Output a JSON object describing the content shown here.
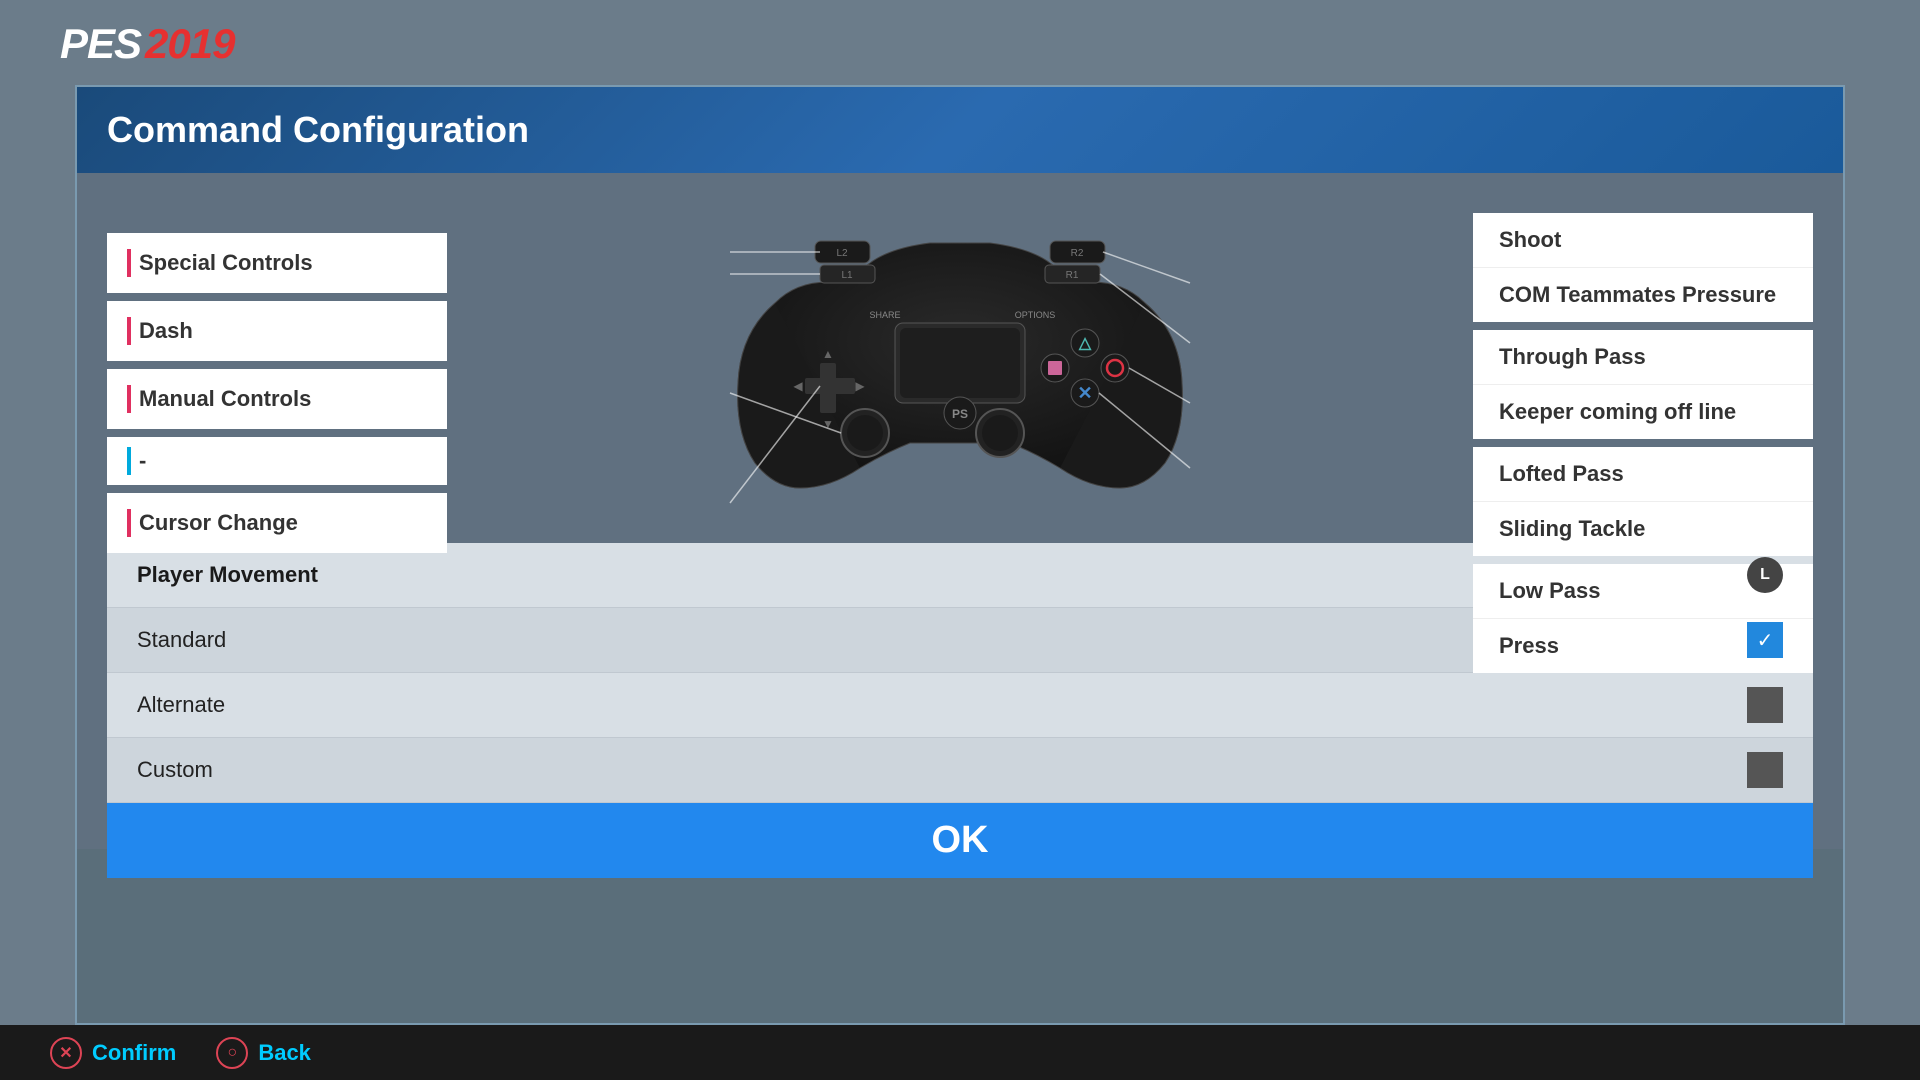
{
  "logo": {
    "pes": "PES",
    "year": "2019"
  },
  "dialog": {
    "title": "Command Configuration"
  },
  "left_labels": [
    {
      "id": "special-controls",
      "indicator": "red",
      "text": "Special Controls"
    },
    {
      "id": "dash",
      "indicator": "red",
      "text": "Dash"
    },
    {
      "id": "manual-controls",
      "indicator": "red",
      "text": "Manual Controls"
    },
    {
      "id": "dash-placeholder",
      "indicator": "blue",
      "text": "-"
    },
    {
      "id": "cursor-change",
      "indicator": "red",
      "text": "Cursor Change"
    }
  ],
  "right_groups": [
    {
      "items": [
        {
          "indicator": "red",
          "text": "Shoot"
        },
        {
          "indicator": "blue",
          "text": "COM Teammates Pressure"
        }
      ]
    },
    {
      "items": [
        {
          "indicator": "red",
          "text": "Through Pass"
        },
        {
          "indicator": "blue",
          "text": "Keeper coming off line"
        }
      ]
    },
    {
      "items": [
        {
          "indicator": "red",
          "text": "Lofted Pass"
        },
        {
          "indicator": "blue",
          "text": "Sliding Tackle"
        }
      ]
    },
    {
      "items": [
        {
          "indicator": "red",
          "text": "Low Pass"
        },
        {
          "indicator": "blue",
          "text": "Press"
        }
      ]
    }
  ],
  "list_rows": [
    {
      "label": "Player Movement",
      "type": "stick",
      "value": "L"
    },
    {
      "label": "Standard",
      "type": "checkbox",
      "checked": true
    },
    {
      "label": "Alternate",
      "type": "checkbox",
      "checked": false
    },
    {
      "label": "Custom",
      "type": "checkbox",
      "checked": false
    }
  ],
  "ok_button": "OK",
  "bottom_actions": [
    {
      "icon": "×",
      "icon_type": "cross",
      "label": "Confirm"
    },
    {
      "icon": "○",
      "icon_type": "circle",
      "label": "Back"
    }
  ]
}
